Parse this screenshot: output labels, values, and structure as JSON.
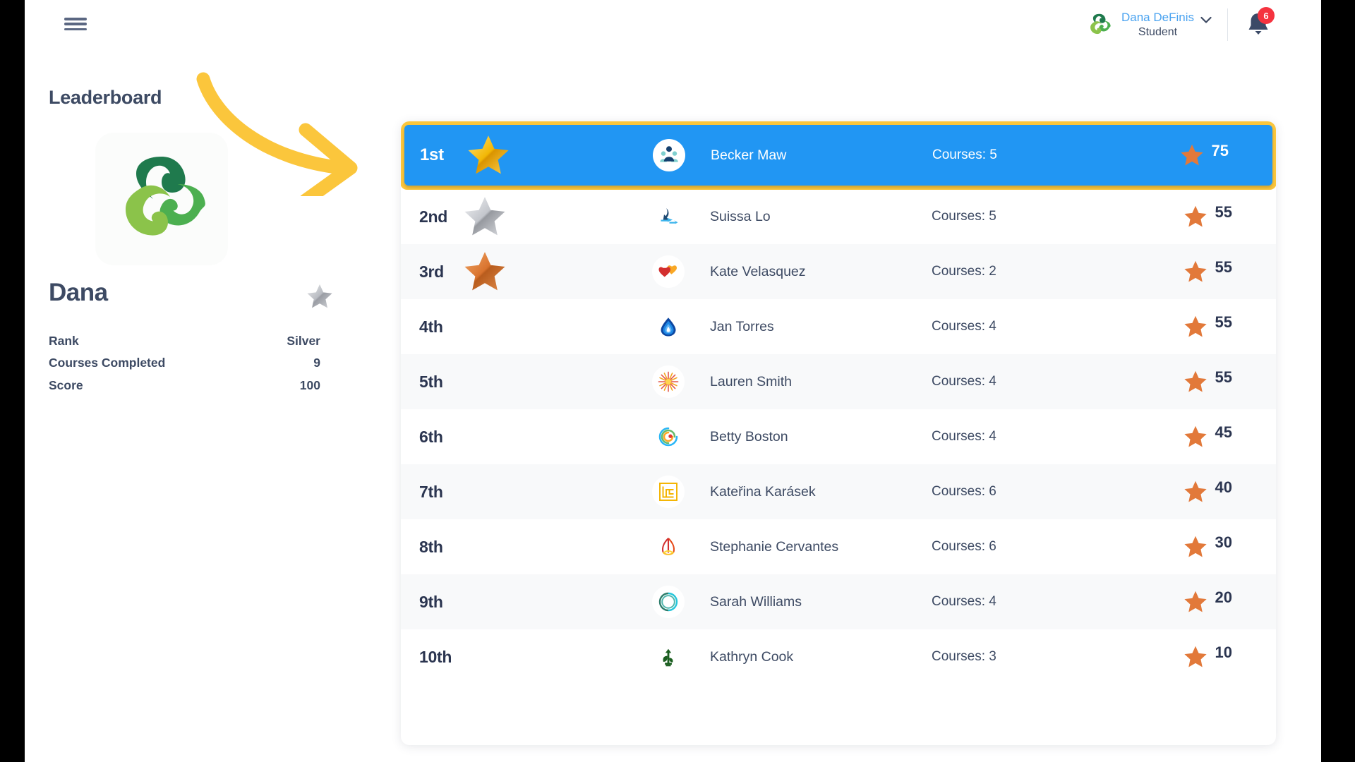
{
  "header": {
    "menu_icon": "hamburger-menu-icon",
    "brand_logo": "company-swirl-logo",
    "user_name": "Dana DeFinis",
    "user_role": "Student",
    "chevron": "∨",
    "bell_icon": "notification-bell-icon",
    "notification_count": "6"
  },
  "sidebar": {
    "title": "Leaderboard",
    "profile_logo": "company-swirl-logo",
    "profile_name": "Dana",
    "profile_rank_badge": "silver-star-icon",
    "stats": [
      {
        "label": "Rank",
        "value": "Silver"
      },
      {
        "label": "Courses Completed",
        "value": "9"
      },
      {
        "label": "Score",
        "value": "100"
      }
    ]
  },
  "annotation": {
    "type": "curved-arrow",
    "color": "#fbc63c",
    "points_to": "leaderboard-row-1"
  },
  "colors": {
    "highlight_row": "#2196f3",
    "highlight_border": "#fbc63c",
    "text": "#3d4a63",
    "link": "#4aa3f0",
    "badge": "#f5333f",
    "alt_row": "#f8f9fa"
  },
  "leaderboard": {
    "courses_prefix": "Courses: ",
    "rows": [
      {
        "rank": "1st",
        "medal": "gold-star-medal",
        "avatar": "avatar-people-group-icon",
        "name": "Becker Maw",
        "courses": "Courses: 5",
        "score": "75",
        "highlighted": true,
        "alt": false
      },
      {
        "rank": "2nd",
        "medal": "silver-star-medal",
        "avatar": "avatar-blue-arrows-icon",
        "name": "Suissa Lo",
        "courses": "Courses: 5",
        "score": "55",
        "highlighted": false,
        "alt": false
      },
      {
        "rank": "3rd",
        "medal": "bronze-star-medal",
        "avatar": "avatar-two-hearts-icon",
        "name": "Kate Velasquez",
        "courses": "Courses: 2",
        "score": "55",
        "highlighted": false,
        "alt": true
      },
      {
        "rank": "4th",
        "medal": "",
        "avatar": "avatar-water-drop-icon",
        "name": "Jan Torres",
        "courses": "Courses: 4",
        "score": "55",
        "highlighted": false,
        "alt": false
      },
      {
        "rank": "5th",
        "medal": "",
        "avatar": "avatar-sunburst-icon",
        "name": "Lauren Smith",
        "courses": "Courses: 4",
        "score": "55",
        "highlighted": false,
        "alt": true
      },
      {
        "rank": "6th",
        "medal": "",
        "avatar": "avatar-rainbow-spiral-icon",
        "name": "Betty Boston",
        "courses": "Courses: 4",
        "score": "45",
        "highlighted": false,
        "alt": false
      },
      {
        "rank": "7th",
        "medal": "",
        "avatar": "avatar-yellow-maze-icon",
        "name": "Kateřina Karásek",
        "courses": "Courses: 6",
        "score": "40",
        "highlighted": false,
        "alt": true
      },
      {
        "rank": "8th",
        "medal": "",
        "avatar": "avatar-red-leaf-icon",
        "name": "Stephanie Cervantes",
        "courses": "Courses: 6",
        "score": "30",
        "highlighted": false,
        "alt": false
      },
      {
        "rank": "9th",
        "medal": "",
        "avatar": "avatar-teal-ring-icon",
        "name": "Sarah Williams",
        "courses": "Courses: 4",
        "score": "20",
        "highlighted": false,
        "alt": true
      },
      {
        "rank": "10th",
        "medal": "",
        "avatar": "avatar-green-sprout-icon",
        "name": "Kathryn Cook",
        "courses": "Courses: 3",
        "score": "10",
        "highlighted": false,
        "alt": false
      }
    ]
  }
}
